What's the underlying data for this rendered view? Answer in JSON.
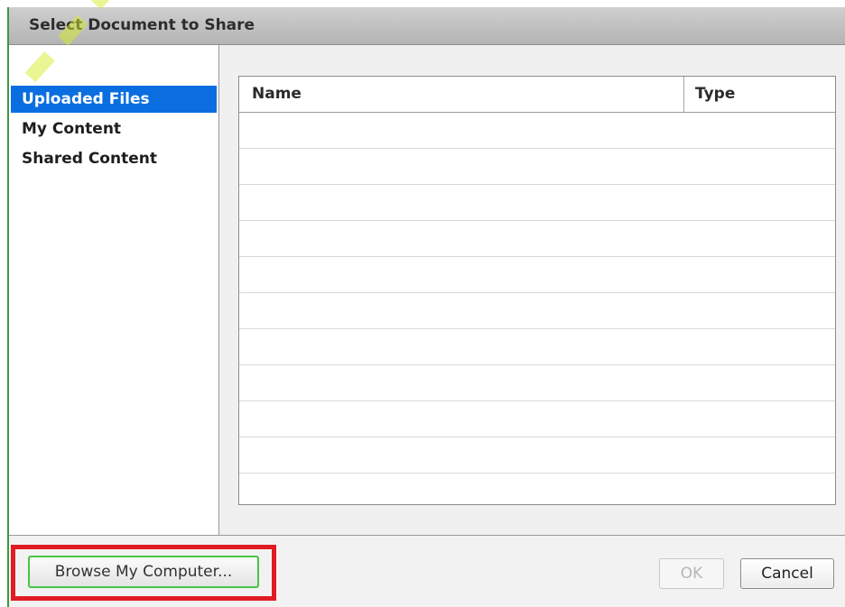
{
  "dialog": {
    "title": "Select Document to Share"
  },
  "sidebar": {
    "items": [
      {
        "label": "Uploaded Files",
        "selected": true
      },
      {
        "label": "My Content",
        "selected": false
      },
      {
        "label": "Shared Content",
        "selected": false
      }
    ]
  },
  "file_list": {
    "columns": [
      "Name",
      "Type"
    ],
    "rows": []
  },
  "footer": {
    "browse_label": "Browse My Computer...",
    "ok_label": "OK",
    "cancel_label": "Cancel"
  },
  "colors": {
    "selection": "#0b6ee0",
    "highlight_frame": "#e01b24",
    "browse_focus": "#47c447"
  }
}
